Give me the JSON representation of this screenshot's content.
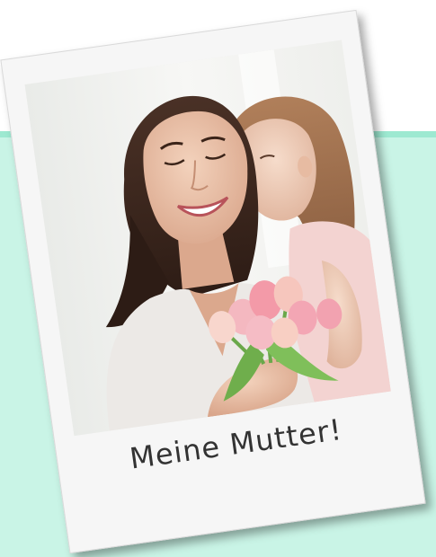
{
  "card": {
    "caption": "Meine Mutter!"
  },
  "photo": {
    "subject": "mother-and-daughter-with-tulips-photo"
  },
  "colors": {
    "background": "#ffffff",
    "mint_panel": "#c9f4e6",
    "mint_stripe": "#9de9d1",
    "card": "#f6f6f6",
    "caption_text": "#333333"
  }
}
